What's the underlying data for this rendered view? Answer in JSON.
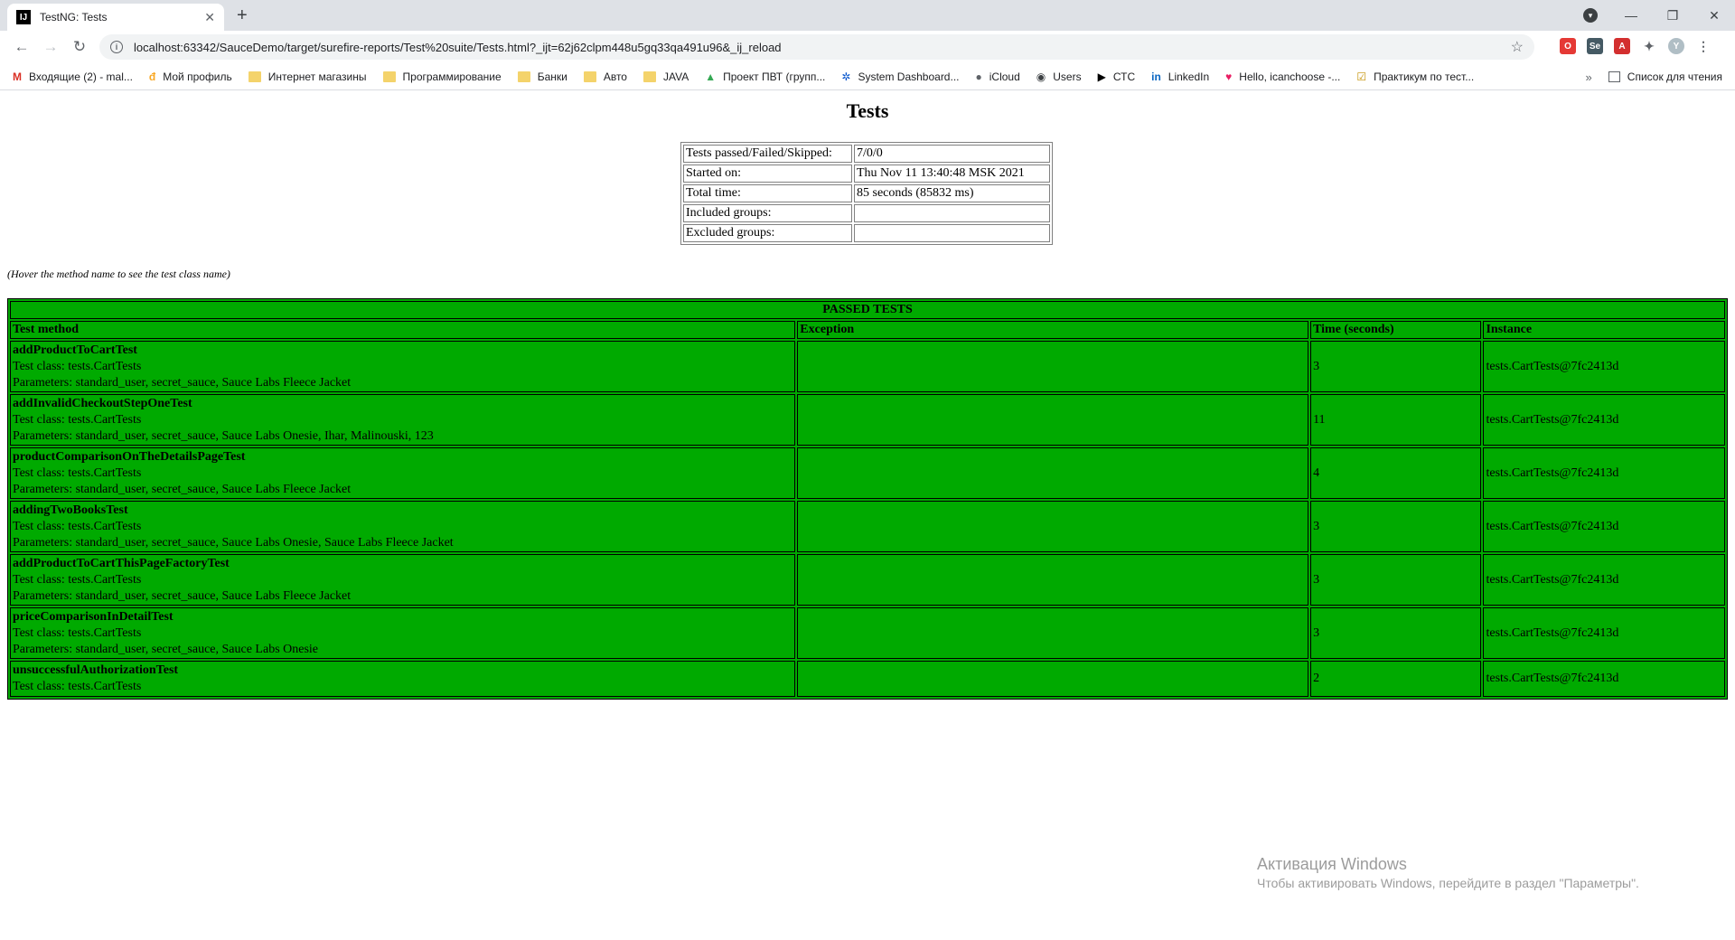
{
  "browser": {
    "tab_title": "TestNG: Tests",
    "tab_favicon": "IJ",
    "url": "localhost:63342/SauceDemo/target/surefire-reports/Test%20suite/Tests.html?_ijt=62j62clpm448u5gq33qa491u96&_ij_reload",
    "bookmarks": [
      {
        "label": "Входящие (2) - mal...",
        "icon": "gmail-icon"
      },
      {
        "label": "Мой профиль",
        "icon": "profile-icon"
      },
      {
        "label": "Интернет магазины",
        "icon": "folder-icon"
      },
      {
        "label": "Программирование",
        "icon": "folder-icon"
      },
      {
        "label": "Банки",
        "icon": "folder-icon"
      },
      {
        "label": "Авто",
        "icon": "folder-icon"
      },
      {
        "label": "JAVA",
        "icon": "folder-icon"
      },
      {
        "label": "Проект ПВТ (групп...",
        "icon": "drive-icon"
      },
      {
        "label": "System Dashboard...",
        "icon": "jira-icon"
      },
      {
        "label": "iCloud",
        "icon": "apple-icon"
      },
      {
        "label": "Users",
        "icon": "globe-icon"
      },
      {
        "label": "СТС",
        "icon": "play-icon"
      },
      {
        "label": "LinkedIn",
        "icon": "linkedin-icon"
      },
      {
        "label": "Hello, icanchoose -...",
        "icon": "heart-icon"
      },
      {
        "label": "Практикум по тест...",
        "icon": "checkbox-icon"
      }
    ],
    "reading_list": "Список для чтения"
  },
  "page": {
    "title": "Tests",
    "summary": [
      {
        "label": "Tests passed/Failed/Skipped:",
        "value": "7/0/0"
      },
      {
        "label": "Started on:",
        "value": "Thu Nov 11 13:40:48 MSK 2021"
      },
      {
        "label": "Total time:",
        "value": "85 seconds (85832 ms)"
      },
      {
        "label": "Included groups:",
        "value": ""
      },
      {
        "label": "Excluded groups:",
        "value": ""
      }
    ],
    "hint": "(Hover the method name to see the test class name)",
    "passed_header": "PASSED TESTS",
    "columns": [
      "Test method",
      "Exception",
      "Time (seconds)",
      "Instance"
    ],
    "rows": [
      {
        "method": "addProductToCartTest",
        "class": "Test class: tests.CartTests",
        "params": "Parameters: standard_user, secret_sauce, Sauce Labs Fleece Jacket",
        "exception": "",
        "time": "3",
        "instance": "tests.CartTests@7fc2413d"
      },
      {
        "method": "addInvalidCheckoutStepOneTest",
        "class": "Test class: tests.CartTests",
        "params": "Parameters: standard_user, secret_sauce, Sauce Labs Onesie, Ihar, Malinouski, 123",
        "exception": "",
        "time": "11",
        "instance": "tests.CartTests@7fc2413d"
      },
      {
        "method": "productComparisonOnTheDetailsPageTest",
        "class": "Test class: tests.CartTests",
        "params": "Parameters: standard_user, secret_sauce, Sauce Labs Fleece Jacket",
        "exception": "",
        "time": "4",
        "instance": "tests.CartTests@7fc2413d"
      },
      {
        "method": "addingTwoBooksTest",
        "class": "Test class: tests.CartTests",
        "params": "Parameters: standard_user, secret_sauce, Sauce Labs Onesie, Sauce Labs Fleece Jacket",
        "exception": "",
        "time": "3",
        "instance": "tests.CartTests@7fc2413d"
      },
      {
        "method": "addProductToCartThisPageFactoryTest",
        "class": "Test class: tests.CartTests",
        "params": "Parameters: standard_user, secret_sauce, Sauce Labs Fleece Jacket",
        "exception": "",
        "time": "3",
        "instance": "tests.CartTests@7fc2413d"
      },
      {
        "method": "priceComparisonInDetailTest",
        "class": "Test class: tests.CartTests",
        "params": "Parameters: standard_user, secret_sauce, Sauce Labs Onesie",
        "exception": "",
        "time": "3",
        "instance": "tests.CartTests@7fc2413d"
      },
      {
        "method": "unsuccessfulAuthorizationTest",
        "class": "Test class: tests.CartTests",
        "params": "",
        "exception": "",
        "time": "2",
        "instance": "tests.CartTests@7fc2413d"
      }
    ]
  },
  "watermark": {
    "title": "Активация Windows",
    "subtitle": "Чтобы активировать Windows, перейдите в раздел \"Параметры\"."
  },
  "colors": {
    "passed_bg": "#00aa00",
    "chrome_bg": "#dee1e6"
  }
}
